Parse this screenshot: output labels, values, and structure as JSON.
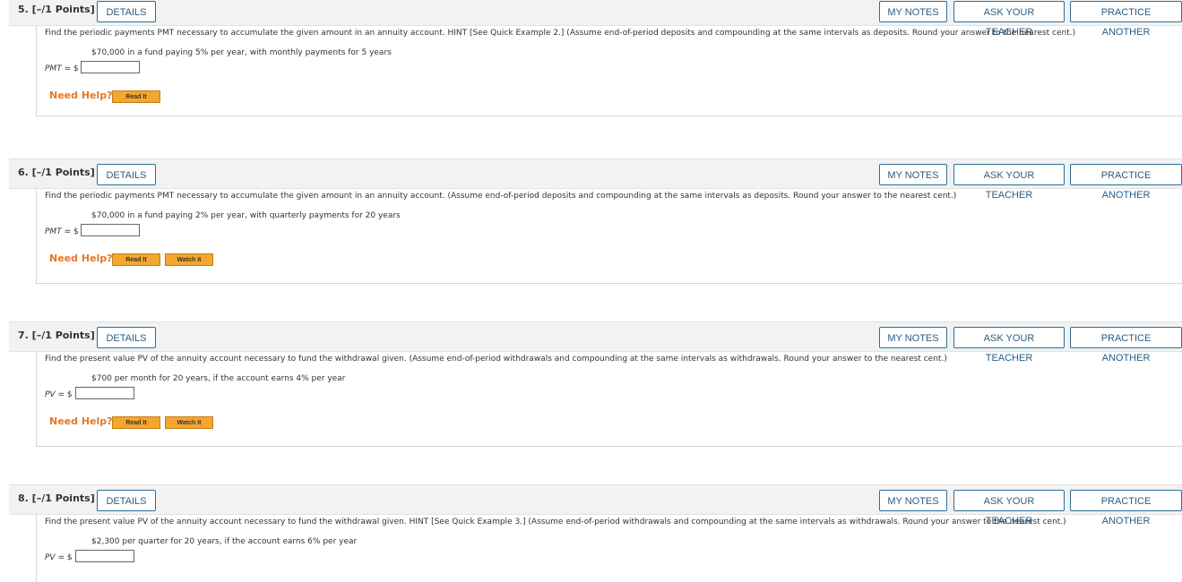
{
  "buttons": {
    "details": "DETAILS",
    "my_notes": "MY NOTES",
    "ask_teacher": "ASK YOUR TEACHER",
    "practice_another": "PRACTICE ANOTHER",
    "read_it": "Read It",
    "watch_it": "Watch It"
  },
  "need_help": "Need Help?",
  "questions": [
    {
      "number": "5. [–/1 Points]",
      "instruction": "Find the periodic payments PMT necessary to accumulate the given amount in an annuity account. HINT [See Quick Example 2.] (Assume end-of-period deposits and compounding at the same intervals as deposits. Round your answer to the nearest cent.)",
      "given": "$70,000 in a fund paying 5% per year, with monthly payments for 5 years",
      "answer_var": "PMT",
      "answer_prefix": " = $",
      "answer_value": ""
    },
    {
      "number": "6. [–/1 Points]",
      "instruction": "Find the periodic payments PMT necessary to accumulate the given amount in an annuity account. (Assume end-of-period deposits and compounding at the same intervals as deposits. Round your answer to the nearest cent.)",
      "given": "$70,000 in a fund paying 2% per year, with quarterly payments for 20 years",
      "answer_var": "PMT",
      "answer_prefix": " = $",
      "answer_value": ""
    },
    {
      "number": "7. [–/1 Points]",
      "instruction": "Find the present value PV of the annuity account necessary to fund the withdrawal given. (Assume end-of-period withdrawals and compounding at the same intervals as withdrawals. Round your answer to the nearest cent.)",
      "given": "$700 per month for 20 years, if the account earns 4% per year",
      "answer_var": "PV",
      "answer_prefix": " = $",
      "answer_value": ""
    },
    {
      "number": "8. [–/1 Points]",
      "instruction": "Find the present value PV of the annuity account necessary to fund the withdrawal given. HINT [See Quick Example 3.] (Assume end-of-period withdrawals and compounding at the same intervals as withdrawals. Round your answer to the nearest cent.)",
      "given": "$2,300 per quarter for 20 years, if the account earns 6% per year",
      "answer_var": "PV",
      "answer_prefix": " = $",
      "answer_value": ""
    }
  ],
  "colors": {
    "button_border": "#2d6f97",
    "button_text": "#2a5d84",
    "need_help": "#e87722",
    "help_button": "#f4a72c"
  }
}
